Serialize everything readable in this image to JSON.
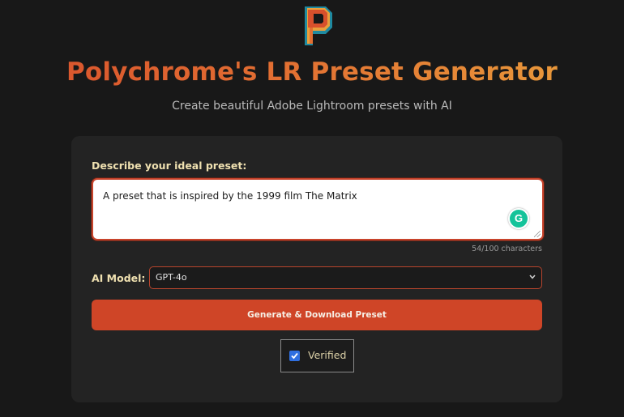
{
  "header": {
    "logo_icon": "polychrome-p-logo-icon",
    "title": "Polychrome's LR Preset Generator",
    "subtitle": "Create beautiful Adobe Lightroom presets with AI"
  },
  "form": {
    "description_label": "Describe your ideal preset:",
    "description_value": "A preset that is inspired by the 1999 film The Matrix",
    "char_count": "54/100 characters",
    "model_label": "AI Model:",
    "model_selected": "GPT-4o",
    "generate_button": "Generate & Download Preset",
    "verified_label": "Verified",
    "verified_checked": true
  },
  "colors": {
    "background": "#181818",
    "card": "#232323",
    "accent": "#cf4527",
    "label": "#efe0b0"
  }
}
